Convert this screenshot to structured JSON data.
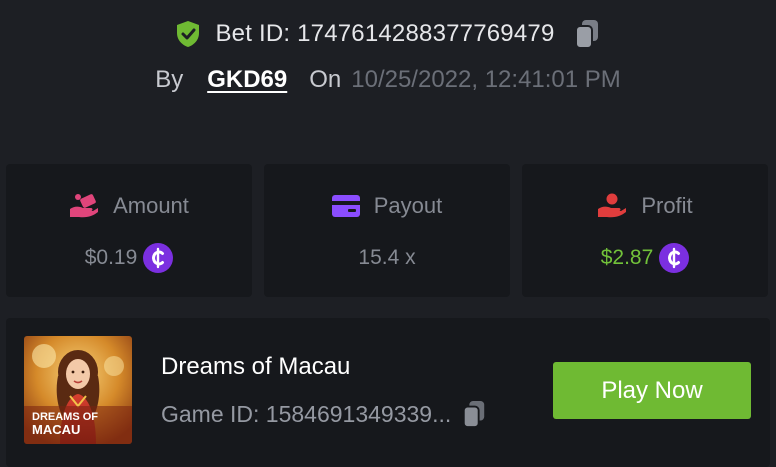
{
  "bet": {
    "id_label": "Bet ID: 1747614288377769479",
    "by_label": "By",
    "username": "GKD69",
    "on_label": "On",
    "datetime": "10/25/2022, 12:41:01 PM"
  },
  "stats": {
    "amount": {
      "label": "Amount",
      "value": "$0.19",
      "icon": "money-hand-icon"
    },
    "payout": {
      "label": "Payout",
      "value": "15.4 x",
      "icon": "credit-card-icon"
    },
    "profit": {
      "label": "Profit",
      "value": "$2.87",
      "icon": "profit-hand-icon"
    }
  },
  "game": {
    "title": "Dreams of Macau",
    "id_label": "Game ID: 1584691349339...",
    "thumb_text_line1": "DREAMS OF",
    "thumb_text_line2": "MACAU",
    "play_label": "Play Now"
  },
  "colors": {
    "background": "#1d1f24",
    "card": "#16181c",
    "accent_green": "#6fba33",
    "profit_green": "#72c23a",
    "coin_purple": "#7b2fe0",
    "shield_green": "#6fba33",
    "amount_pink": "#e0457b",
    "payout_purple": "#8b4dff",
    "profit_red": "#e03d3d"
  }
}
